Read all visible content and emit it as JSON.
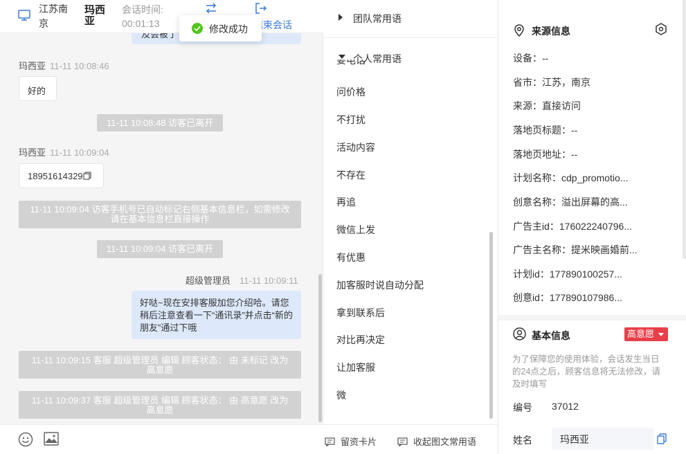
{
  "header": {
    "location": "江苏南京",
    "visitor_name": "玛西亚",
    "session_time_label": "会话时间:",
    "session_time_value": "00:01:13",
    "end_session_label": "结束会话"
  },
  "toast": {
    "text": "修改成功"
  },
  "messages": {
    "partial_agent_text": "及会被了",
    "m1_sender": "玛西亚",
    "m1_time": "11-11 10:08:46",
    "m1_text": "好的",
    "sys1": "11-11 10:08:48 访客已离开",
    "m2_sender": "玛西亚",
    "m2_time": "11-11 10:09:04",
    "m2_text": "18951614329",
    "sys2": "11-11 10:09:04 访客手机号已自动标记右侧基本信息栏，如需修改请在基本信息栏直接操作",
    "sys3": "11-11 10:09:04 访客已离开",
    "agent_sender": "超级管理员",
    "agent_time": "11-11 10:09:11",
    "agent_text": "好哒~现在安排客服加您介绍哈。请您稍后注意查看一下“通讯录”并点击“新的朋友”通过下哦",
    "sys4": "11-11 10:09:15 客服 超级管理员 编辑 顾客状态： 由 未标记 改为 高意愿",
    "sys5": "11-11 10:09:37 客服 超级管理员 编辑 顾客状态： 由 高意愿 改为 高意愿"
  },
  "phrases": {
    "team_group": "团队常用语",
    "personal_group": "个人常用语",
    "cut_item": "要电话",
    "items": [
      "问价格",
      "不打扰",
      "活动内容",
      "不存在",
      "再追",
      "微信上发",
      "有优惠",
      "加客服时说自动分配",
      "拿到联系后",
      "对比再决定",
      "让加客服",
      "微"
    ],
    "footer_card": "留资卡片",
    "footer_collapse": "收起图文常用语"
  },
  "info": {
    "source_title": "来源信息",
    "device": "设备：--",
    "province_city": "省市：江苏，南京",
    "source": "来源：直接访问",
    "landing_title": "落地页标题：--",
    "landing_url": "落地页地址：--",
    "plan_name": "计划名称：cdp_promotio...",
    "creative_name": "创意名称：溢出屏幕的高...",
    "advertiser_id": "广告主id：176022240796...",
    "advertiser_name": "广告主名称：提米映画婚前...",
    "plan_id": "计划id：177890100257...",
    "creative_id": "创意id：177890107986...",
    "basic_title": "基本信息",
    "intent_tag": "高意愿",
    "notice": "为了保障您的使用体验，会话发生当日的24点之后，顾客信息将无法修改，请及时填写",
    "number_label": "编号",
    "number_value": "37012",
    "name_label": "姓名",
    "name_value": "玛西亚"
  },
  "colors": {
    "accent": "#3a7bd5",
    "agent_bubble": "#dde9fb",
    "system_pill": "#d2d2d2",
    "tag_red": "#e8404a",
    "success": "#52c41a"
  }
}
